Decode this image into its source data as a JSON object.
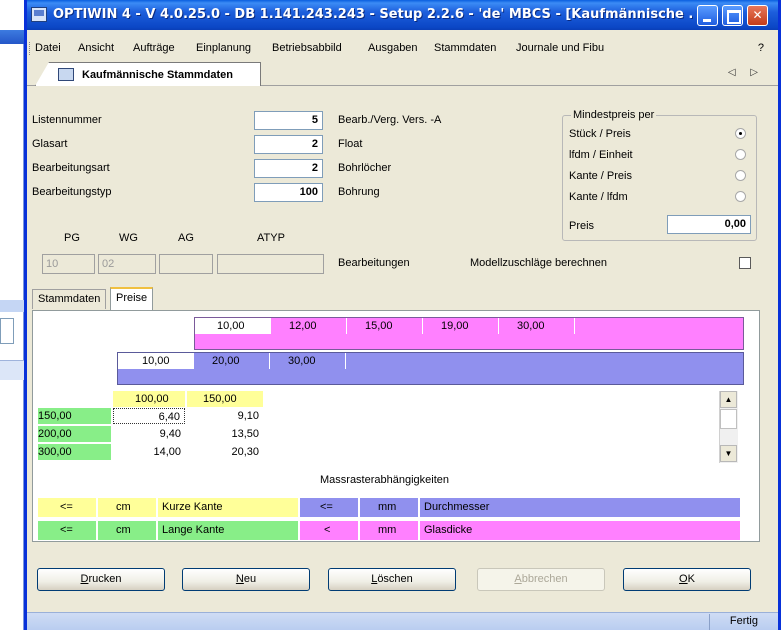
{
  "window": {
    "title": "OPTIWIN 4 - V 4.0.25.0 - DB 1.141.243.243 - Setup 2.2.6 - 'de' MBCS - [Kaufmännische ..."
  },
  "menu": {
    "items": [
      "Datei",
      "Ansicht",
      "Aufträge",
      "Einplanung",
      "Betriebsabbild",
      "Ausgaben",
      "Stammdaten",
      "Journale und Fibu"
    ],
    "help": "?"
  },
  "document_tab": {
    "label": "Kaufmännische Stammdaten",
    "nav": "◁ ▷"
  },
  "fields": {
    "listennummer": {
      "label": "Listennummer",
      "value": "5",
      "desc": "Bearb./Verg. Vers. -A"
    },
    "glasart": {
      "label": "Glasart",
      "value": "2",
      "desc": "Float"
    },
    "bearbeitungsart": {
      "label": "Bearbeitungsart",
      "value": "2",
      "desc": "Bohrlöcher"
    },
    "bearbeitungstyp": {
      "label": "Bearbeitungstyp",
      "value": "100",
      "desc": "Bohrung"
    }
  },
  "mindestpreis": {
    "legend": "Mindestpreis per",
    "options": [
      {
        "label": "Stück / Preis",
        "selected": true
      },
      {
        "label": "lfdm / Einheit",
        "selected": false
      },
      {
        "label": "Kante / Preis",
        "selected": false
      },
      {
        "label": "Kante / lfdm",
        "selected": false
      }
    ],
    "preis_label": "Preis",
    "preis_value": "0,00"
  },
  "codes": {
    "headers": [
      "PG",
      "WG",
      "AG",
      "ATYP"
    ],
    "values": [
      "10",
      "02",
      "",
      ""
    ]
  },
  "bearbeitungen_label": "Bearbeitungen",
  "modellzuschlaege": {
    "label": "Modellzuschläge berechnen",
    "checked": false
  },
  "tabs": [
    {
      "label": "Stammdaten",
      "active": false
    },
    {
      "label": "Preise",
      "active": true
    }
  ],
  "bands": {
    "glasdicke": [
      "10,00",
      "12,00",
      "15,00",
      "19,00",
      "30,00"
    ],
    "durchmesser": [
      "10,00",
      "20,00",
      "30,00"
    ]
  },
  "grid": {
    "columns": [
      "100,00",
      "150,00"
    ],
    "rows": [
      {
        "key": "150,00",
        "cells": [
          "6,40",
          "9,10"
        ]
      },
      {
        "key": "200,00",
        "cells": [
          "9,40",
          "13,50"
        ]
      },
      {
        "key": "300,00",
        "cells": [
          "14,00",
          "20,30"
        ]
      }
    ]
  },
  "massraster": {
    "title": "Massrasterabhängigkeiten",
    "rows": [
      {
        "op1": "<=",
        "unit1": "cm",
        "name1": "Kurze Kante",
        "op2": "<=",
        "unit2": "mm",
        "name2": "Durchmesser"
      },
      {
        "op1": "<=",
        "unit1": "cm",
        "name1": "Lange Kante",
        "op2": "<",
        "unit2": "mm",
        "name2": "Glasdicke"
      }
    ]
  },
  "buttons": {
    "drucken": {
      "pre": "",
      "key": "D",
      "post": "rucken"
    },
    "neu": {
      "pre": "",
      "key": "N",
      "post": "eu"
    },
    "loeschen": {
      "pre": "",
      "key": "L",
      "post": "öschen"
    },
    "abbrechen": {
      "pre": "",
      "key": "A",
      "post": "bbrechen"
    },
    "ok": {
      "pre": "",
      "key": "O",
      "post": "K"
    }
  },
  "status": "Fertig",
  "colors": {
    "title_blue": "#0b47c6",
    "yellow": "#ffff99",
    "green": "#88ee88",
    "violet": "#9090ee",
    "pink": "#ff80ff",
    "status_bar": "#c5d6f4"
  }
}
